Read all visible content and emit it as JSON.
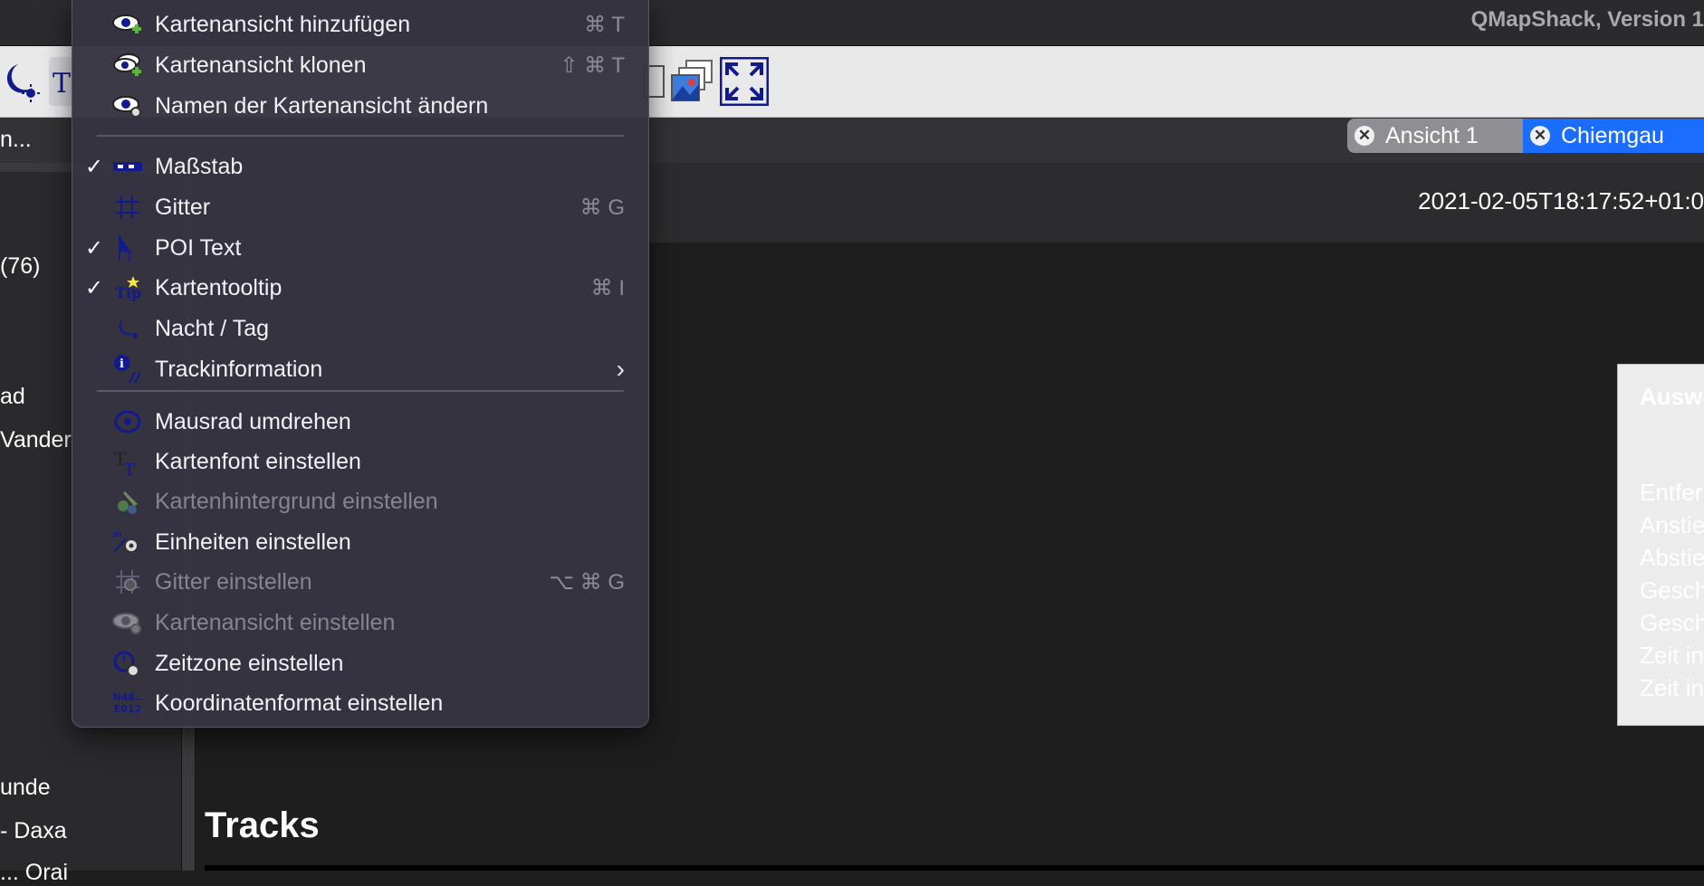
{
  "app": {
    "title": "QMapShack, Version 1"
  },
  "tabs": [
    {
      "label": "Ansicht 1",
      "active": false
    },
    {
      "label": "Chiemgau",
      "active": true
    }
  ],
  "info": {
    "datetime": "2021-02-05T18:17:52+01:0"
  },
  "sidebar": {
    "lines": [
      "n...",
      "(76)",
      "ad",
      "Vander",
      "unde",
      " - Daxa",
      "... Orai"
    ]
  },
  "main": {
    "tracks_heading": "Tracks"
  },
  "right_panel": {
    "title": "Auswe",
    "lines": [
      "Entfer",
      "Anstie",
      "Abstie",
      "Gesch",
      "Gesch",
      "Zeit in",
      "Zeit in"
    ]
  },
  "menu": {
    "items": [
      {
        "label": "Kartenansicht hinzufügen",
        "shortcut": "⌘ T",
        "checked": false,
        "disabled": false,
        "icon": "eye-plus-icon"
      },
      {
        "label": "Kartenansicht klonen",
        "shortcut": "⇧ ⌘ T",
        "checked": false,
        "disabled": false,
        "icon": "eye-clone-icon"
      },
      {
        "label": "Namen der Kartenansicht ändern",
        "shortcut": "",
        "checked": false,
        "disabled": false,
        "icon": "eye-edit-icon"
      },
      {
        "label": "Maßstab",
        "shortcut": "",
        "checked": true,
        "disabled": false,
        "icon": "scale-icon"
      },
      {
        "label": "Gitter",
        "shortcut": "⌘ G",
        "checked": false,
        "disabled": false,
        "icon": "grid-icon"
      },
      {
        "label": "POI Text",
        "shortcut": "",
        "checked": true,
        "disabled": false,
        "icon": "poi-text-icon"
      },
      {
        "label": "Kartentooltip",
        "shortcut": "⌘ I",
        "checked": true,
        "disabled": false,
        "icon": "tooltip-icon"
      },
      {
        "label": "Nacht / Tag",
        "shortcut": "",
        "checked": false,
        "disabled": false,
        "icon": "night-day-icon"
      },
      {
        "label": "Trackinformation",
        "shortcut": "",
        "checked": false,
        "disabled": false,
        "icon": "info-icon",
        "submenu": true
      },
      {
        "label": "Mausrad umdrehen",
        "shortcut": "",
        "checked": false,
        "disabled": false,
        "icon": "mouse-wheel-icon"
      },
      {
        "label": "Kartenfont einstellen",
        "shortcut": "",
        "checked": false,
        "disabled": false,
        "icon": "font-icon"
      },
      {
        "label": "Kartenhintergrund einstellen",
        "shortcut": "",
        "checked": false,
        "disabled": true,
        "icon": "background-icon"
      },
      {
        "label": "Einheiten einstellen",
        "shortcut": "",
        "checked": false,
        "disabled": false,
        "icon": "units-icon"
      },
      {
        "label": "Gitter einstellen",
        "shortcut": "⌥ ⌘ G",
        "checked": false,
        "disabled": true,
        "icon": "grid-settings-icon"
      },
      {
        "label": "Kartenansicht einstellen",
        "shortcut": "",
        "checked": false,
        "disabled": true,
        "icon": "eye-settings-icon"
      },
      {
        "label": "Zeitzone einstellen",
        "shortcut": "",
        "checked": false,
        "disabled": false,
        "icon": "timezone-icon"
      },
      {
        "label": "Koordinatenformat einstellen",
        "shortcut": "",
        "checked": false,
        "disabled": false,
        "icon": "coordinates-icon",
        "icon_text": [
          "N48..",
          "E012"
        ]
      }
    ],
    "check_glyph": "✓",
    "submenu_glyph": "›"
  },
  "colors": {
    "accent": "#1a6dff",
    "menu_bg": "#36343f",
    "icon_blue": "#121a8c"
  }
}
